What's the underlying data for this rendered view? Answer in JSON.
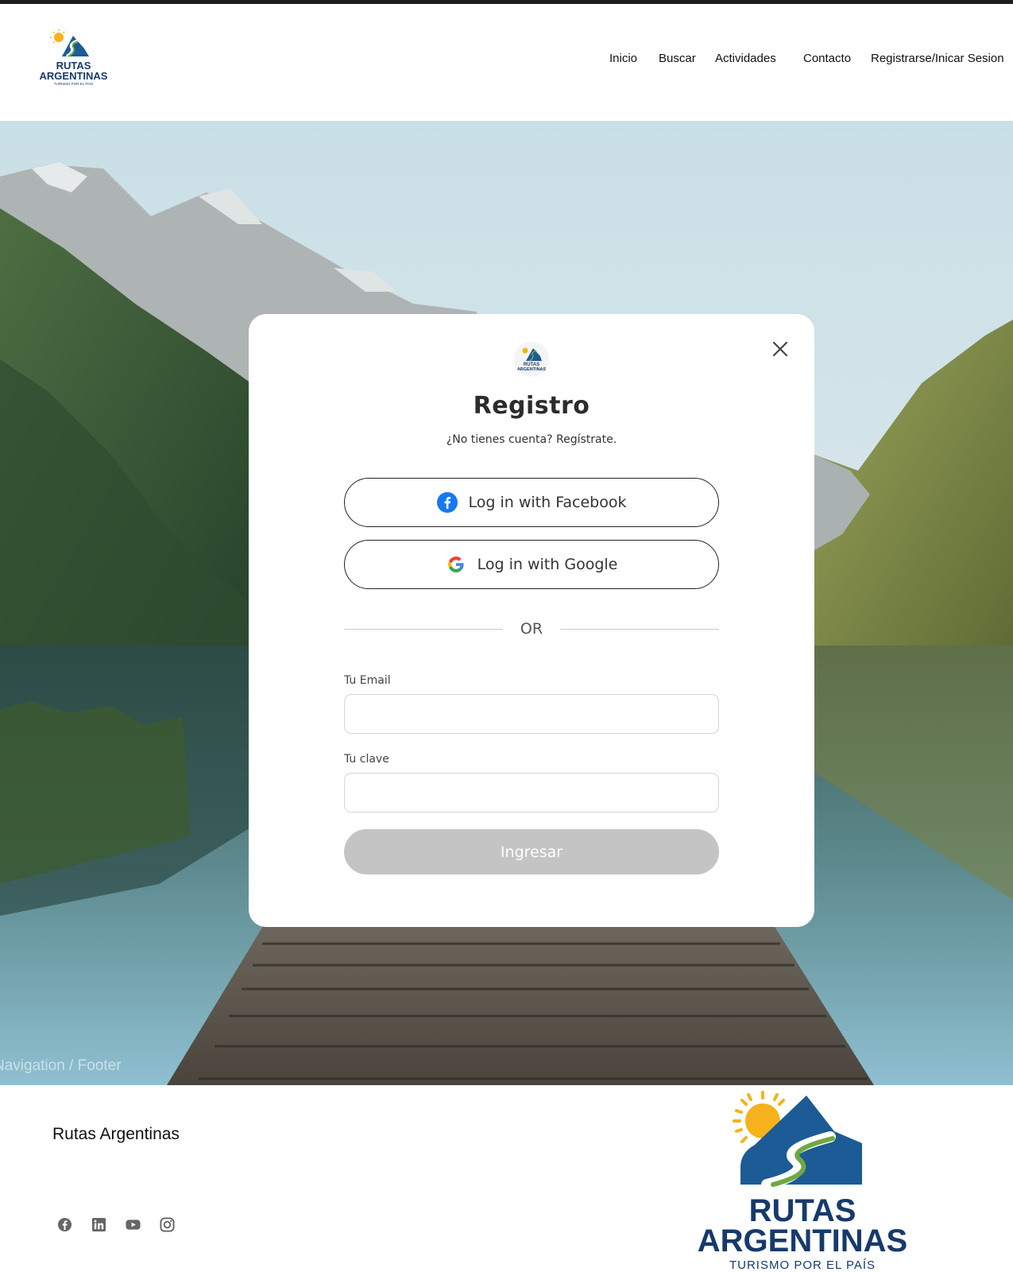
{
  "header": {
    "logo_line1": "RUTAS",
    "logo_line2": "ARGENTINAS",
    "logo_tagline": "TURISMO POR EL PAÍS",
    "nav": [
      {
        "label": "Inicio"
      },
      {
        "label": "Buscar"
      },
      {
        "label": "Actividades"
      },
      {
        "label": "Contacto"
      },
      {
        "label": "Registrarse/Inicar Sesion"
      }
    ]
  },
  "hero": {
    "caption": "Navigation / Footer"
  },
  "modal": {
    "logo_line1": "RUTAS",
    "logo_line2": "ARGENTINAS",
    "title": "Registro",
    "subtitle": "¿No tienes cuenta? Regístrate.",
    "facebook_label": "Log in with Facebook",
    "google_label": "Log in with Google",
    "divider_label": "OR",
    "email_label": "Tu Email",
    "email_value": "",
    "password_label": "Tu clave",
    "password_value": "",
    "submit_label": "Ingresar"
  },
  "footer": {
    "brand": "Rutas Argentinas",
    "social_icons": [
      "facebook-icon",
      "linkedin-icon",
      "youtube-icon",
      "instagram-icon"
    ],
    "logo_line1": "RUTAS",
    "logo_line2": "ARGENTINAS",
    "logo_tagline": "TURISMO POR EL PAÍS"
  },
  "colors": {
    "brand_blue": "#1c5b95",
    "brand_navy": "#173a6c",
    "brand_green": "#6fa842",
    "sun": "#f5b21c",
    "facebook": "#1877f2",
    "button_disabled": "#c4c4c4"
  }
}
